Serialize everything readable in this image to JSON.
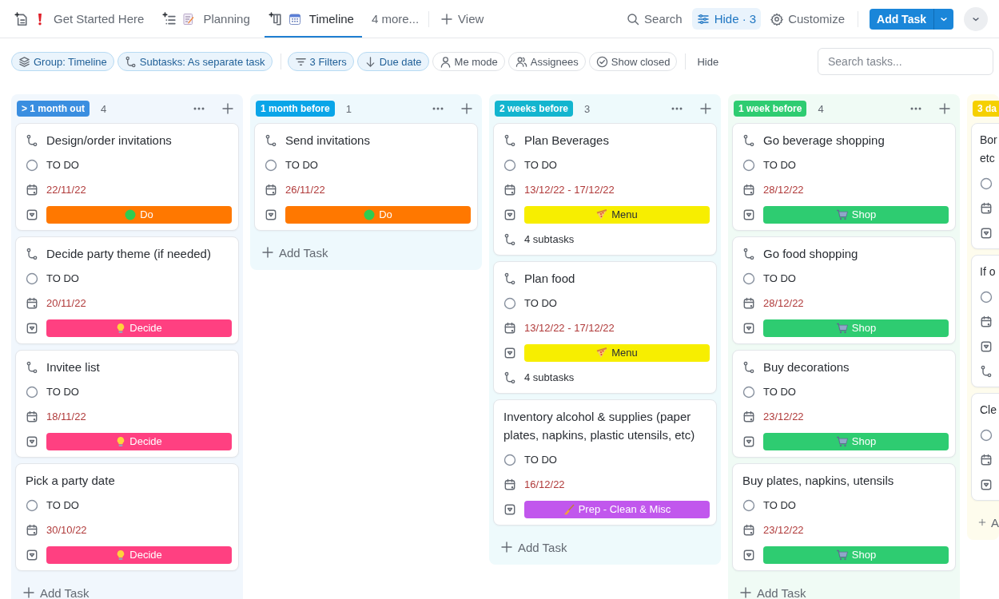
{
  "tabs": [
    {
      "label": "Get Started Here",
      "kind": "doc",
      "selected": false
    },
    {
      "label": "Planning",
      "kind": "list",
      "selected": false
    },
    {
      "label": "Timeline",
      "kind": "board",
      "selected": true
    }
  ],
  "more_tabs": "4 more...",
  "add_view": "View",
  "actions": {
    "search": "Search",
    "hide": "Hide · 3",
    "customize": "Customize",
    "add_task": "Add Task"
  },
  "chips": [
    {
      "label": "Group: Timeline",
      "kind": "layers",
      "active": true
    },
    {
      "label": "Subtasks: As separate task",
      "kind": "subtask",
      "active": true
    },
    {
      "label": "3 Filters",
      "kind": "filter",
      "active": true
    },
    {
      "label": "Due date",
      "kind": "arrow",
      "active": true
    },
    {
      "label": "Me mode",
      "kind": "person",
      "active": false
    },
    {
      "label": "Assignees",
      "kind": "people",
      "active": false
    },
    {
      "label": "Show closed",
      "kind": "check",
      "active": false
    }
  ],
  "hide_link": "Hide",
  "task_search": {
    "placeholder": "Search tasks..."
  },
  "columns": [
    {
      "label": "> 1 month out",
      "color": "#3a8ee0",
      "count": "4",
      "add_task": "Add Task",
      "cards": [
        {
          "title": "Design/order invitations",
          "subtask": true,
          "status": "TO DO",
          "date": "22/11/22",
          "tag": {
            "label": "Do",
            "kind": "dot",
            "color": "#ff7800"
          }
        },
        {
          "title": "Decide party theme (if needed)",
          "subtask": true,
          "status": "TO DO",
          "date": "20/11/22",
          "tag": {
            "label": "Decide",
            "kind": "bulb",
            "color": "#ff4081"
          }
        },
        {
          "title": "Invitee list",
          "subtask": true,
          "status": "TO DO",
          "date": "18/11/22",
          "tag": {
            "label": "Decide",
            "kind": "bulb",
            "color": "#ff4081"
          }
        },
        {
          "title": "Pick a party date",
          "subtask": false,
          "status": "TO DO",
          "date": "30/10/22",
          "tag": {
            "label": "Decide",
            "kind": "bulb",
            "color": "#ff4081"
          }
        }
      ]
    },
    {
      "label": "1 month before",
      "color": "#0aa5e8",
      "count": "1",
      "add_task": "Add Task",
      "cards": [
        {
          "title": "Send invitations",
          "subtask": true,
          "status": "TO DO",
          "date": "26/11/22",
          "tag": {
            "label": "Do",
            "kind": "dot",
            "color": "#ff7800"
          }
        }
      ]
    },
    {
      "label": "2 weeks before",
      "color": "#13b5cf",
      "count": "3",
      "add_task": "Add Task",
      "cards": [
        {
          "title": "Plan Beverages",
          "subtask": true,
          "status": "TO DO",
          "date": "13/12/22 - 17/12/22",
          "tag": {
            "label": "Menu",
            "kind": "pizza",
            "color": "#f7ee00"
          },
          "subtasks": "4 subtasks"
        },
        {
          "title": "Plan food",
          "subtask": true,
          "status": "TO DO",
          "date": "13/12/22 - 17/12/22",
          "tag": {
            "label": "Menu",
            "kind": "pizza",
            "color": "#f7ee00"
          },
          "subtasks": "4 subtasks"
        },
        {
          "title": "Inventory alcohol & supplies (paper plates, napkins, plastic utensils, etc)",
          "subtask": false,
          "status": "TO DO",
          "date": "16/12/22",
          "tag": {
            "label": "Prep - Clean & Misc",
            "kind": "broom",
            "color": "#c157ed"
          }
        }
      ]
    },
    {
      "label": "1 week before",
      "color": "#2ecc71",
      "count": "4",
      "add_task": "Add Task",
      "cards": [
        {
          "title": "Go beverage shopping",
          "subtask": true,
          "status": "TO DO",
          "date": "28/12/22",
          "tag": {
            "label": "Shop",
            "kind": "cart",
            "color": "#2ecc71"
          }
        },
        {
          "title": "Go food shopping",
          "subtask": true,
          "status": "TO DO",
          "date": "28/12/22",
          "tag": {
            "label": "Shop",
            "kind": "cart",
            "color": "#2ecc71"
          }
        },
        {
          "title": "Buy decorations",
          "subtask": true,
          "status": "TO DO",
          "date": "23/12/22",
          "tag": {
            "label": "Shop",
            "kind": "cart",
            "color": "#2ecc71"
          }
        },
        {
          "title": "Buy plates, napkins, utensils",
          "subtask": false,
          "status": "TO DO",
          "date": "23/12/22",
          "tag": {
            "label": "Shop",
            "kind": "cart",
            "color": "#2ecc71"
          }
        }
      ]
    },
    {
      "label": "3 da",
      "color": "#f5d000",
      "add_task": "A",
      "cards": [
        {
          "title": "Bor\netc",
          "subtask": false
        },
        {
          "title": "If o",
          "subtask": false,
          "subtask_row": true
        },
        {
          "title": "Cle",
          "subtask": false
        }
      ]
    }
  ]
}
